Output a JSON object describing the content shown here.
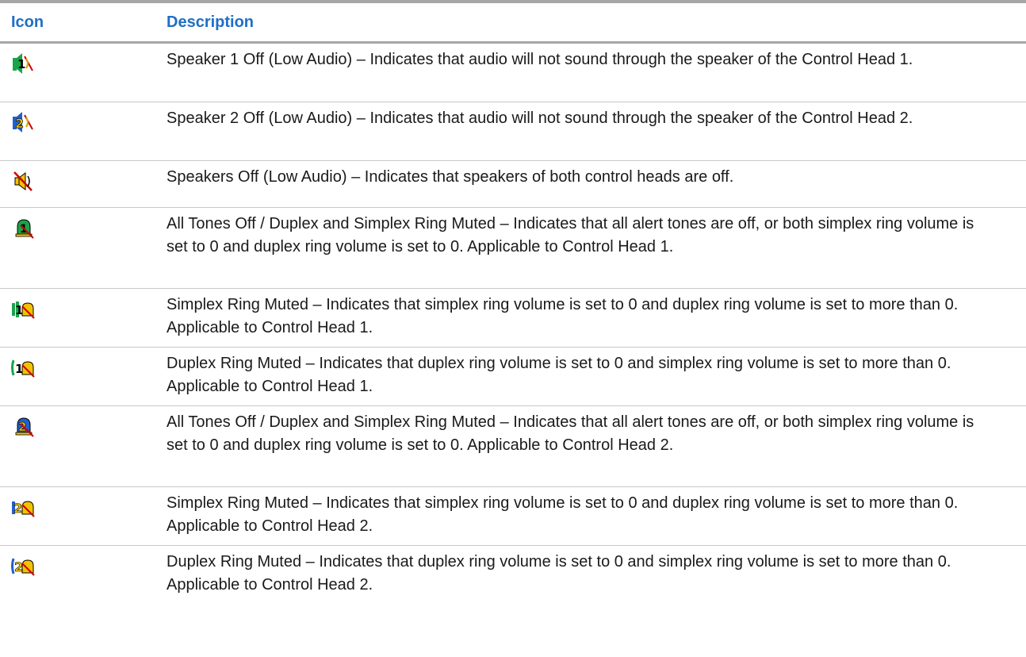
{
  "headers": {
    "icon": "Icon",
    "description": "Description"
  },
  "rows": [
    {
      "icon": "speaker-1-off-icon",
      "description": "Speaker 1 Off (Low Audio) – Indicates that audio will not sound through the speaker of the Control Head 1."
    },
    {
      "icon": "speaker-2-off-icon",
      "description": "Speaker 2 Off (Low Audio) – Indicates that audio will not sound through the speaker of the Control Head 2."
    },
    {
      "icon": "speakers-off-icon",
      "description": "Speakers Off (Low Audio) – Indicates that speakers of both control heads are off."
    },
    {
      "icon": "all-tones-off-head-1-icon",
      "description": "All Tones Off / Duplex and Simplex Ring Muted – Indicates that all alert tones are off, or both simplex ring volume is set to 0 and duplex ring volume is set to 0. Applicable to Control Head 1."
    },
    {
      "icon": "simplex-ring-muted-head-1-icon",
      "description": "Simplex Ring Muted – Indicates that simplex ring volume is set to 0 and duplex ring volume is set to more than 0. Applicable to Control Head 1."
    },
    {
      "icon": "duplex-ring-muted-head-1-icon",
      "description": "Duplex Ring Muted – Indicates that duplex ring volume is set to 0 and simplex ring volume is set to more than 0. Applicable to Control Head 1."
    },
    {
      "icon": "all-tones-off-head-2-icon",
      "description": "All Tones Off / Duplex and Simplex Ring Muted – Indicates that all alert tones are off, or both simplex ring volume is set to 0 and duplex ring volume is set to 0. Applicable to Control Head 2."
    },
    {
      "icon": "simplex-ring-muted-head-2-icon",
      "description": "Simplex Ring Muted – Indicates that simplex ring volume is set to 0 and duplex ring volume is set to more than 0. Applicable to Control Head 2."
    },
    {
      "icon": "duplex-ring-muted-head-2-icon",
      "description": "Duplex Ring Muted – Indicates that duplex ring volume is set to 0 and simplex ring volume is set to more than 0. Applicable to Control Head 2."
    }
  ],
  "colors": {
    "header_text": "#1f6fc5",
    "rule": "#a6a6a6"
  }
}
